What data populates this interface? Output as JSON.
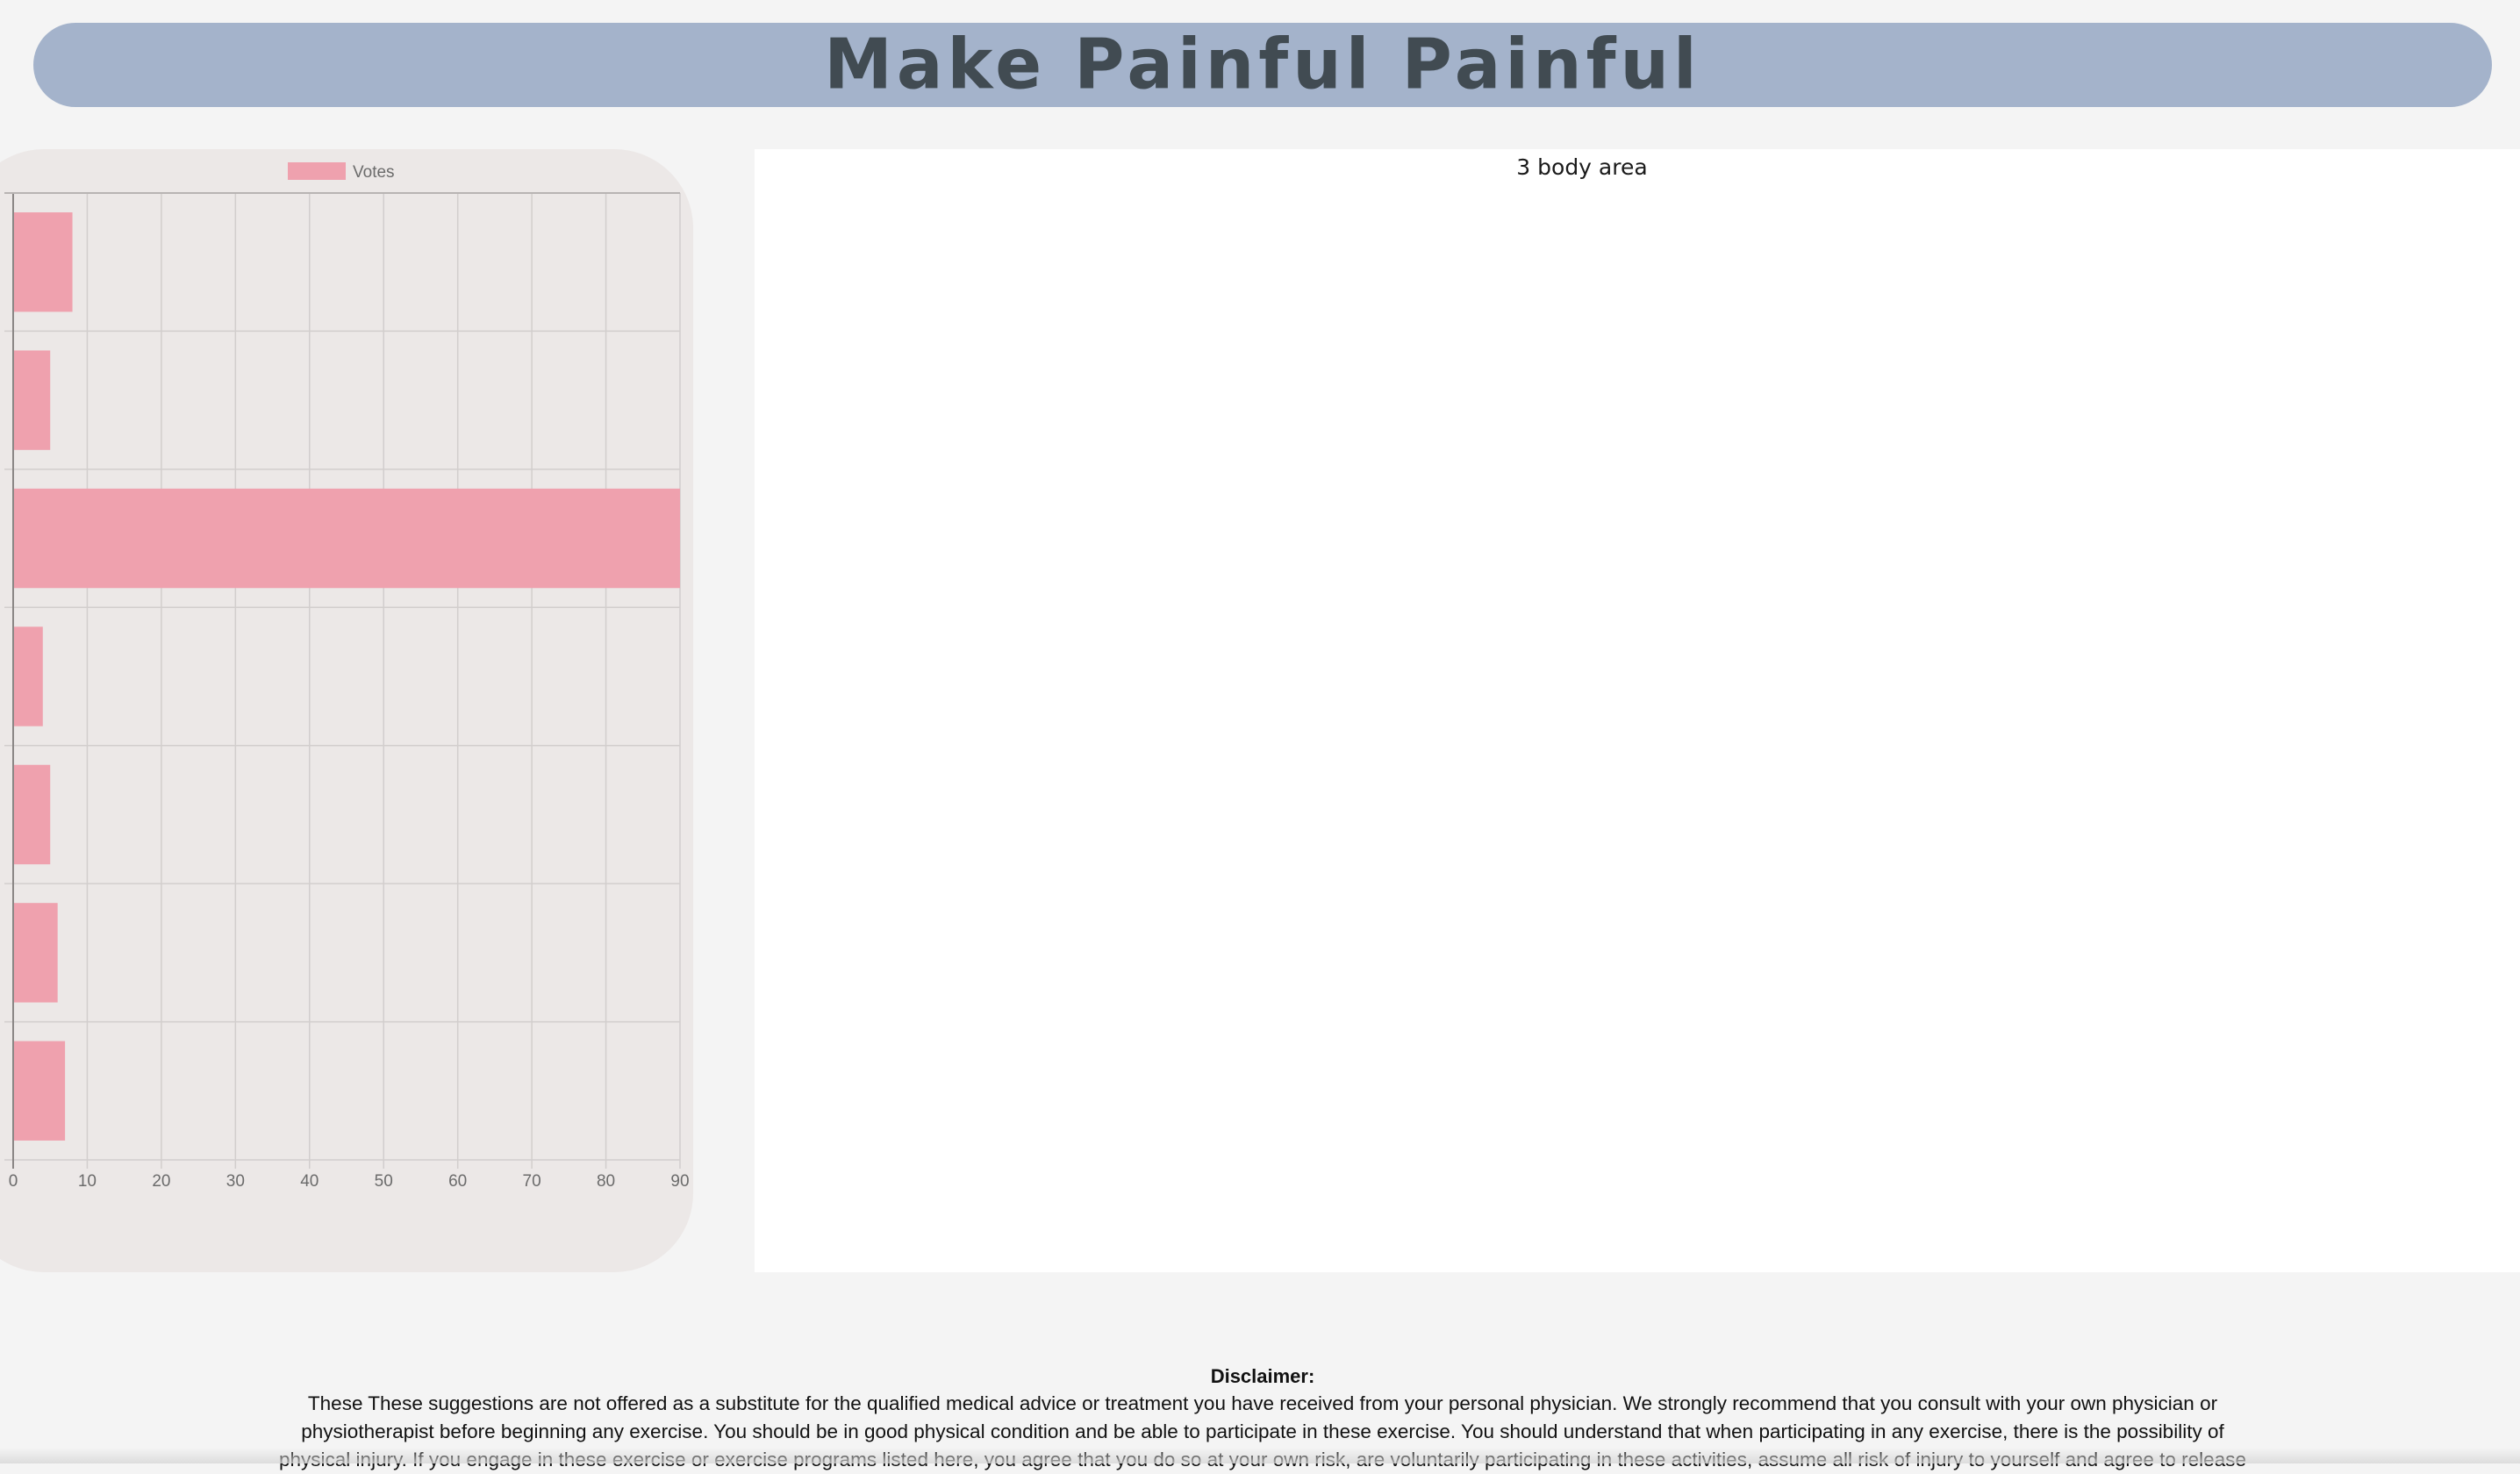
{
  "header": {
    "title": "Make Painful Painful"
  },
  "body_area": {
    "label": "3 body area"
  },
  "disclaimer": {
    "title": "Disclaimer:",
    "body": "These These suggestions are not offered as a substitute for the qualified medical advice or treatment you have received from your personal physician. We strongly recommend that you consult with your own physician or physiotherapist before beginning any exercise. You should be in good physical condition and be able to participate in these exercise. You should understand that when participating in any exercise, there is the possibility of physical injury. If you engage in these exercise or exercise programs listed here, you agree that you do so at your own risk, are voluntarily participating in these activities, assume all risk of injury to yourself and agree to release"
  },
  "colors": {
    "bar_fill": "#efa1ae",
    "banner": "#a4b3cb",
    "panel": "#ece8e7"
  },
  "chart_data": {
    "type": "bar",
    "orientation": "horizontal",
    "legend": "Votes",
    "legend_position": "top",
    "grid": true,
    "xlim": [
      0,
      90
    ],
    "x_ticks": [
      "0",
      "10",
      "20",
      "30",
      "40",
      "50",
      "60",
      "70",
      "80",
      "90"
    ],
    "values": [
      8,
      5,
      90,
      4,
      5,
      6,
      7
    ]
  }
}
